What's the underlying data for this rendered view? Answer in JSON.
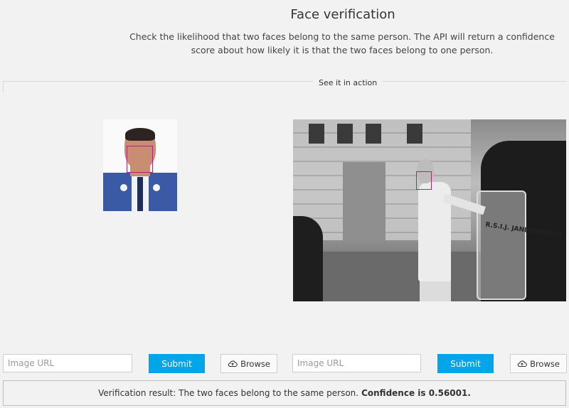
{
  "header": {
    "title": "Face verification",
    "description": "Check the likelihood that two faces belong to the same person. The API will return a confidence score about how likely it is that the two faces belong to one person."
  },
  "section_label": "See it in action",
  "left_panel": {
    "url_placeholder": "Image URL",
    "submit_label": "Submit",
    "browse_label": "Browse"
  },
  "right_panel": {
    "url_placeholder": "Image URL",
    "submit_label": "Submit",
    "browse_label": "Browse",
    "shield_text": "R.S.I.J. JANDARMERIA"
  },
  "result": {
    "message": "Verification result: The two faces belong to the same person.",
    "confidence": "Confidence is 0.56001."
  },
  "colors": {
    "accent": "#00a6e8",
    "face_box": "#b0247a"
  },
  "icons": {
    "browse": "cloud-upload-icon"
  }
}
